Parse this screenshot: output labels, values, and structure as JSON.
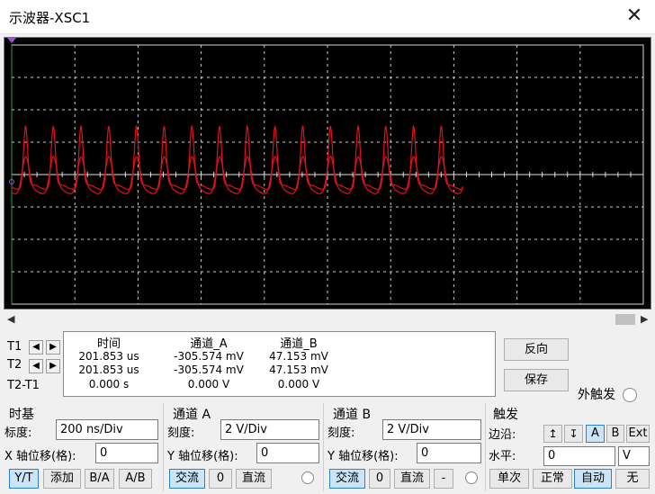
{
  "window": {
    "title": "示波器-XSC1",
    "close_icon": "✕"
  },
  "screen": {
    "background": "#000000",
    "trace_color": "#e5101c",
    "grid_divisions": {
      "x": 10,
      "y": 8
    }
  },
  "readout": {
    "t1_label": "T1",
    "t2_label": "T2",
    "diff_label": "T2-T1",
    "headers": {
      "time": "时间",
      "ch_a": "通道_A",
      "ch_b": "通道_B"
    },
    "rows": [
      {
        "time": "201.853 us",
        "a": "-305.574 mV",
        "b": "47.153 mV"
      },
      {
        "time": "201.853 us",
        "a": "-305.574 mV",
        "b": "47.153 mV"
      },
      {
        "time": "0.000 s",
        "a": "0.000 V",
        "b": "0.000 V"
      }
    ]
  },
  "side": {
    "reverse": "反向",
    "save": "保存",
    "ext_trigger": "外触发"
  },
  "timebase": {
    "title": "时基",
    "scale_label": "标度:",
    "scale_value": "200 ns/Div",
    "xpos_label": "X 轴位移(格):",
    "xpos_value": "0",
    "mode_yt": "Y/T",
    "mode_add": "添加",
    "mode_ba": "B/A",
    "mode_ab": "A/B"
  },
  "channel_a": {
    "title": "通道 A",
    "scale_label": "刻度:",
    "scale_value": "2  V/Div",
    "ypos_label": "Y 轴位移(格):",
    "ypos_value": "0",
    "ac": "交流",
    "zero": "0",
    "dc": "直流"
  },
  "channel_b": {
    "title": "通道 B",
    "scale_label": "刻度:",
    "scale_value": "2  V/Div",
    "ypos_label": "Y 轴位移(格):",
    "ypos_value": "0",
    "ac": "交流",
    "zero": "0",
    "dc": "直流",
    "minus": "-"
  },
  "trigger": {
    "title": "触发",
    "edge_label": "边沿:",
    "level_label": "水平:",
    "level_value": "0",
    "level_unit": "V",
    "src_a": "A",
    "src_b": "B",
    "src_ext": "Ext",
    "single": "单次",
    "normal": "正常",
    "auto": "自动",
    "none": "无"
  }
}
